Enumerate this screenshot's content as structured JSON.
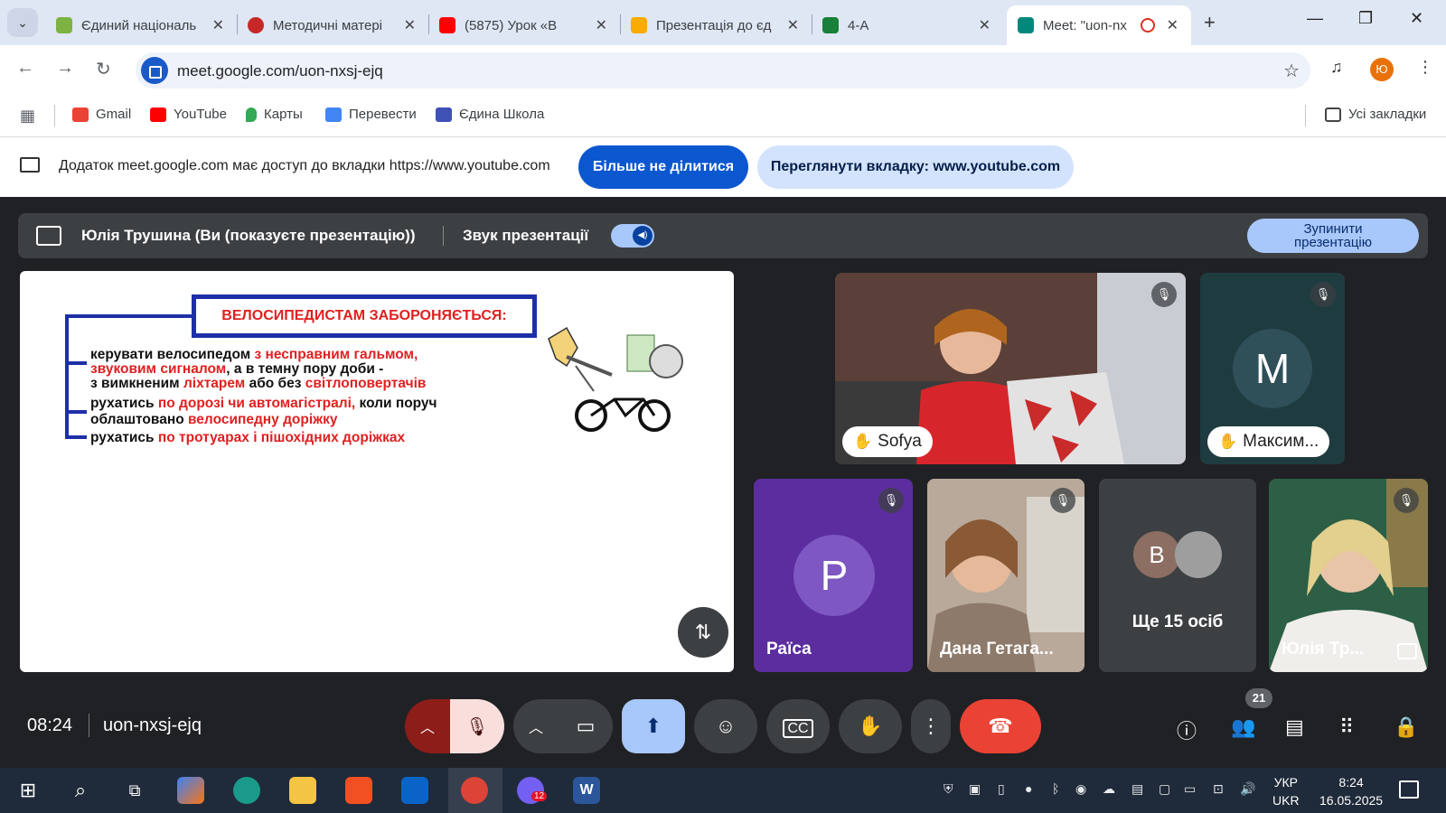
{
  "browser": {
    "tabs": [
      {
        "title": "Єдиний національ",
        "favicon_color": "#7cb342"
      },
      {
        "title": "Методичні матері",
        "favicon_color": "#c62828"
      },
      {
        "title": "(5875) Урок «В",
        "favicon_color": "#ff0000"
      },
      {
        "title": "Презентація до єд",
        "favicon_color": "#f9ab00"
      },
      {
        "title": "4-А",
        "favicon_color": "#188038"
      },
      {
        "title": "Meet: \"uon-nx",
        "favicon_color": "#00897b"
      }
    ],
    "url": "meet.google.com/uon-nxsj-ejq",
    "profile_initial": "Ю",
    "bookmarks": [
      {
        "label": "Gmail",
        "color": "#ea4335"
      },
      {
        "label": "YouTube",
        "color": "#ff0000"
      },
      {
        "label": "Карты",
        "color": "#34a853"
      },
      {
        "label": "Перевести",
        "color": "#4285f4"
      },
      {
        "label": "Єдина Школа",
        "color": "#3f51b5"
      }
    ],
    "all_bookmarks": "Усі закладки"
  },
  "share_banner": {
    "text": "Додаток meet.google.com має доступ до вкладки https://www.youtube.com",
    "stop_sharing": "Більше не ділитися",
    "view_tab": "Переглянути вкладку: www.youtube.com"
  },
  "presentation_bar": {
    "presenter": "Юлія Трушина (Ви (показуєте презентацію))",
    "audio_label": "Звук презентації",
    "audio_on": true,
    "stop_line1": "Зупинити",
    "stop_line2": "презентацію"
  },
  "slide": {
    "title": "ВЕЛОСИПЕДИСТАМ ЗАБОРОНЯЄТЬСЯ:",
    "lines": [
      {
        "black": "керувати велосипедом ",
        "red": "з несправним гальмом,"
      },
      {
        "black": "",
        "red": "звуковим сигналом",
        "black2": ", а в темну пору доби -"
      },
      {
        "black": "з вимкненим ",
        "red": "ліхтарем",
        "black2": " або без ",
        "red2": "світлоповертачів"
      },
      {
        "black": "рухатись ",
        "red": "по дорозі чи автомагістралі,",
        "black2": " коли поруч"
      },
      {
        "black": "облаштовано ",
        "red": "велосипедну доріжку"
      },
      {
        "black": "рухатись ",
        "red": "по тротуарах і пішохідних доріжках"
      }
    ]
  },
  "participants": {
    "sofya": {
      "name": "Sofya",
      "hand_raised": true,
      "muted": true
    },
    "maksym": {
      "name": "Максим...",
      "initial": "M",
      "hand_raised": true,
      "muted": true,
      "avatar_color": "#2f4f59"
    },
    "raisa": {
      "name": "Раїса",
      "initial": "Р",
      "muted": true,
      "tile_color": "#5b2d9e",
      "avatar_color": "#7e57c2"
    },
    "dana": {
      "name": "Дана Гетага...",
      "muted": true
    },
    "others": {
      "initial": "В",
      "label": "Ще 15 осіб",
      "avatar_color": "#8d6e63"
    },
    "yulia": {
      "name": "Юлія Тр...",
      "muted": true
    }
  },
  "controls": {
    "time": "08:24",
    "meeting_code": "uon-nxsj-ejq",
    "people_count": "21"
  },
  "taskbar": {
    "lang_line1": "УКР",
    "lang_line2": "UKR",
    "time": "8:24",
    "date": "16.05.2025",
    "viber_badge": "12"
  }
}
